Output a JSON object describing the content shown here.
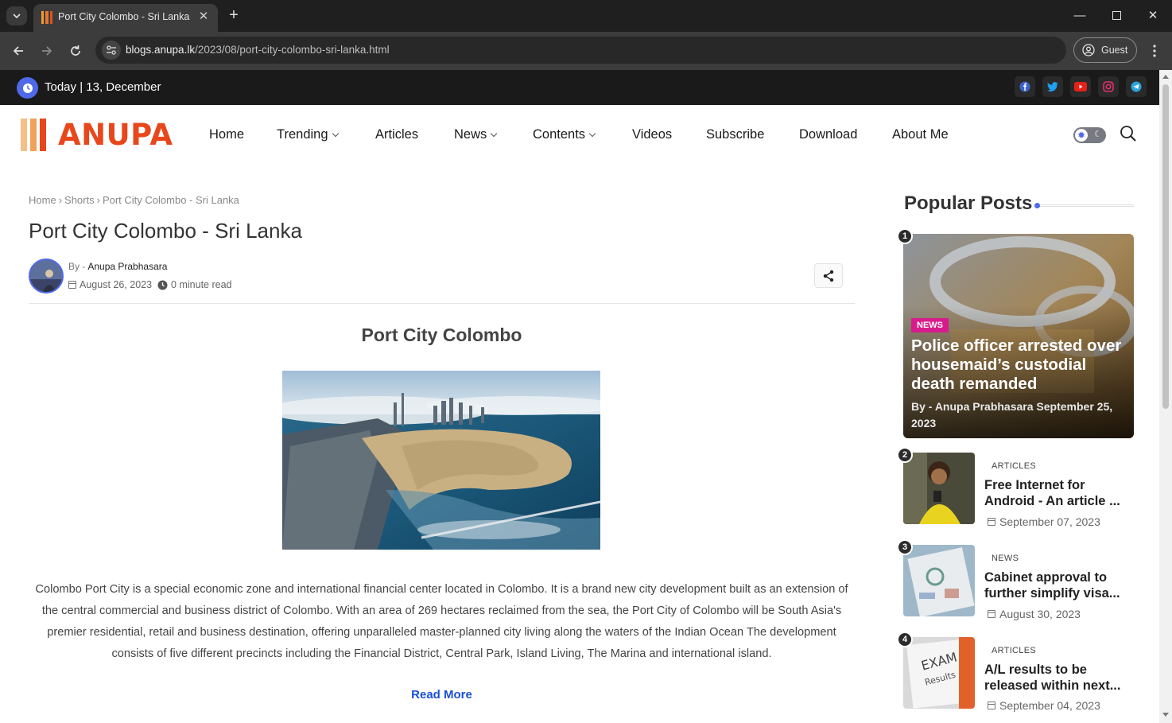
{
  "browser": {
    "tab_title": "Port City Colombo - Sri Lanka",
    "url_domain": "blogs.anupa.lk",
    "url_path": "/2023/08/port-city-colombo-sri-lanka.html",
    "profile_label": "Guest"
  },
  "topbar": {
    "today_label": "Today",
    "date": "13, December",
    "social_icons": [
      "facebook-icon",
      "twitter-icon",
      "youtube-icon",
      "instagram-icon",
      "telegram-icon"
    ]
  },
  "header": {
    "logo_text": "ANUPA",
    "nav": [
      {
        "label": "Home"
      },
      {
        "label": "Trending"
      },
      {
        "label": "Articles"
      },
      {
        "label": "News"
      },
      {
        "label": "Contents"
      },
      {
        "label": "Videos"
      },
      {
        "label": "Subscribe"
      },
      {
        "label": "Download"
      },
      {
        "label": "About Me"
      }
    ]
  },
  "article": {
    "breadcrumb": [
      "Home",
      "Shorts",
      "Port City Colombo - Sri Lanka"
    ],
    "title": "Port City Colombo - Sri Lanka",
    "by_prefix": "By -",
    "author": "Anupa Prabhasara",
    "date": "August 26, 2023",
    "read_time": "0 minute read",
    "section_heading": "Port City Colombo",
    "body": "Colombo Port City is a special economic zone and international financial center located in Colombo. It is a brand new city development built as an extension of the central commercial and business district of Colombo. With an area of 269 hectares reclaimed from the sea, the Port City of Colombo will be South Asia's premier residential, retail and business destination, offering unparalleled master-planned city living along the waters of the Indian Ocean The development consists of five different precincts including the Financial District, Central Park, Island Living, The Marina and international island.",
    "read_more": "Read More"
  },
  "sidebar": {
    "title": "Popular Posts",
    "featured": {
      "rank": "1",
      "tag": "NEWS",
      "title": "Police officer arrested over housemaid’s custodial death remanded",
      "meta": "By - Anupa Prabhasara  September 25, 2023"
    },
    "items": [
      {
        "rank": "2",
        "category": "ARTICLES",
        "title_line1": "Free Internet for",
        "title_line2": "Android - An article ...",
        "date": "September 07, 2023"
      },
      {
        "rank": "3",
        "category": "NEWS",
        "title_line1": "Cabinet approval to",
        "title_line2": "further simplify visa...",
        "date": "August 30, 2023"
      },
      {
        "rank": "4",
        "category": "ARTICLES",
        "title_line1": "A/L results to be",
        "title_line2": "released within next...",
        "date": "September 04, 2023"
      }
    ]
  },
  "colors": {
    "accent": "#4f6ae8",
    "logo": "#e8471c",
    "news_tag": "#d81b8c",
    "link": "#1a4fd8"
  }
}
